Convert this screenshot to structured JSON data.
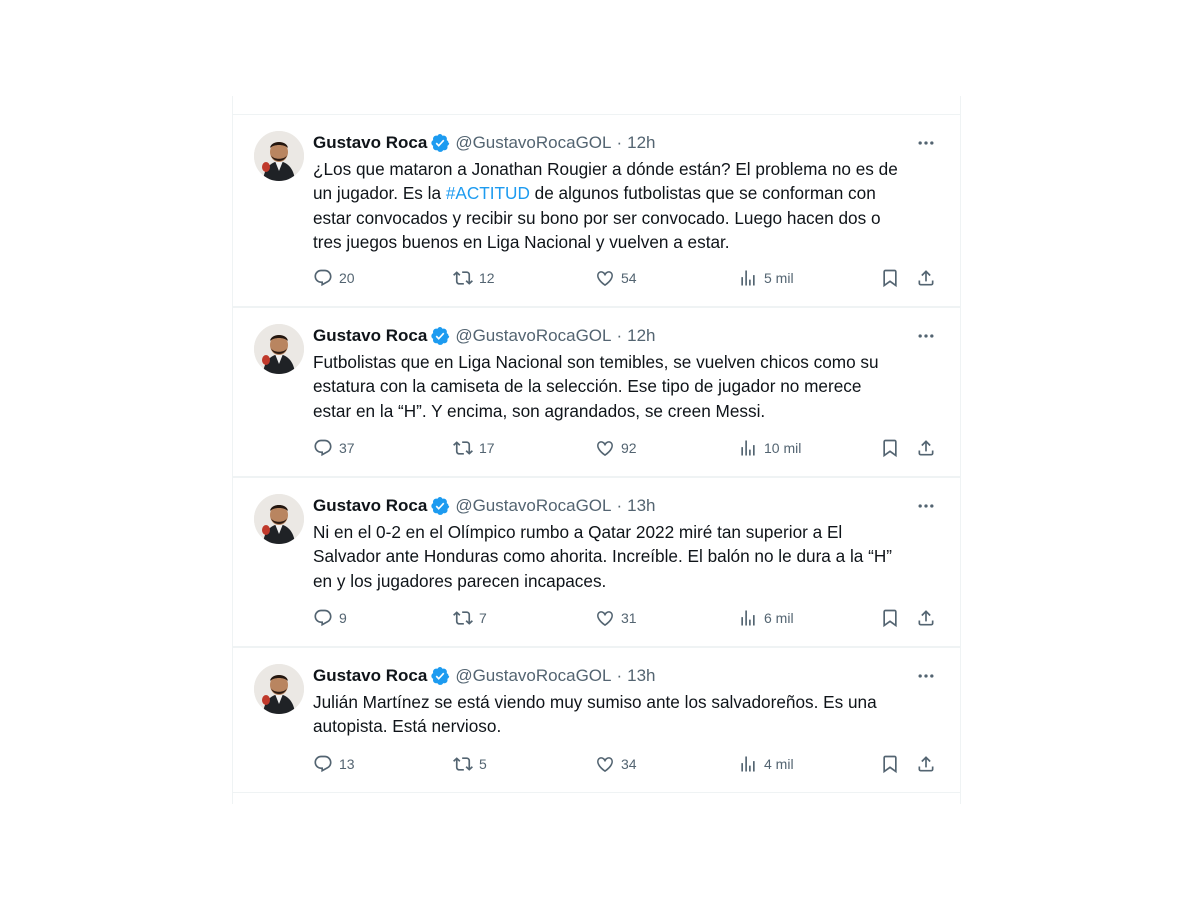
{
  "tweets": [
    {
      "author": "Gustavo Roca",
      "handle": "@GustavoRocaGOL",
      "separator": "·",
      "time": "12h",
      "text_before": "¿Los que mataron a Jonathan Rougier a dónde están? El problema no es de\nun jugador. Es la ",
      "hashtag": "#ACTITUD",
      "text_after": " de algunos futbolistas que se conforman con\nestar convocados y recibir su bono por ser convocado. Luego hacen dos o\ntres juegos buenos en Liga Nacional y vuelven a estar.",
      "replies": "20",
      "reposts": "12",
      "likes": "54",
      "views": "5 mil"
    },
    {
      "author": "Gustavo Roca",
      "handle": "@GustavoRocaGOL",
      "separator": "·",
      "time": "12h",
      "text": "Futbolistas que en Liga Nacional son temibles, se vuelven chicos como su\nestatura con la camiseta de la selección. Ese tipo de jugador no merece\nestar en la “H”. Y encima, son agrandados, se creen Messi.",
      "replies": "37",
      "reposts": "17",
      "likes": "92",
      "views": "10 mil"
    },
    {
      "author": "Gustavo Roca",
      "handle": "@GustavoRocaGOL",
      "separator": "·",
      "time": "13h",
      "text": "Ni en el 0-2 en el Olímpico rumbo a Qatar 2022 miré tan superior a El\nSalvador ante Honduras como ahorita. Increíble. El balón no le dura a la “H”\nen y los jugadores parecen incapaces.",
      "replies": "9",
      "reposts": "7",
      "likes": "31",
      "views": "6 mil"
    },
    {
      "author": "Gustavo Roca",
      "handle": "@GustavoRocaGOL",
      "separator": "·",
      "time": "13h",
      "text": "Julián Martínez se está viendo muy sumiso ante los salvadoreños. Es una\nautopista. Está nervioso.",
      "replies": "13",
      "reposts": "5",
      "likes": "34",
      "views": "4 mil"
    }
  ],
  "colors": {
    "text": "#0f1419",
    "secondary": "#536471",
    "hashtag": "#1d9bf0",
    "verified": "#1d9bf0",
    "border": "#eff3f4"
  },
  "icons": [
    "verified-badge-icon",
    "more-icon",
    "reply-icon",
    "repost-icon",
    "like-icon",
    "views-icon",
    "bookmark-icon",
    "share-icon"
  ]
}
